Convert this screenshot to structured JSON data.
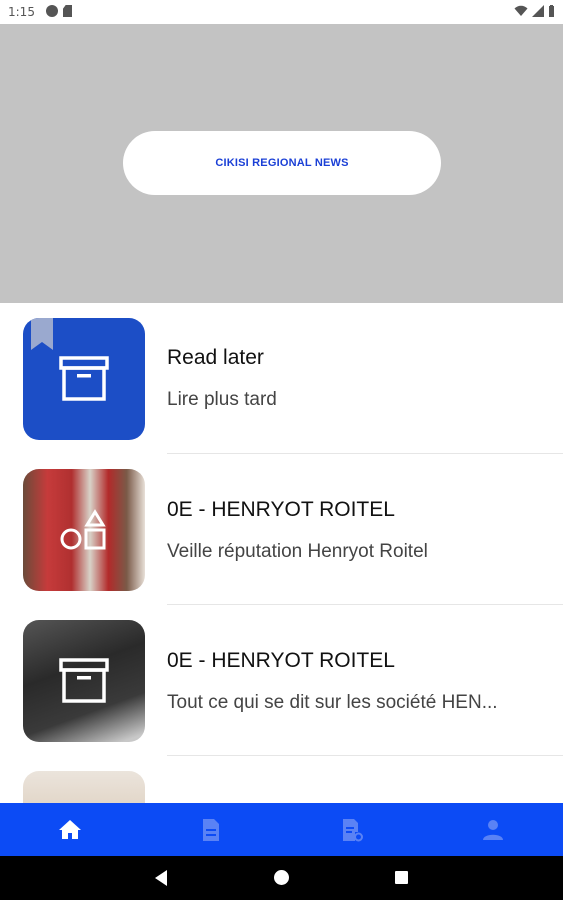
{
  "status_bar": {
    "time": "1:15"
  },
  "header": {
    "brand": "CIKISI REGIONAL NEWS"
  },
  "list": {
    "items": [
      {
        "title": "Read later",
        "subtitle": "Lire plus tard",
        "icon": "archive-box-icon"
      },
      {
        "title": "0E - HENRYOT ROITEL",
        "subtitle": "Veille réputation Henryot Roitel",
        "icon": "shapes-icon"
      },
      {
        "title": "0E - HENRYOT ROITEL",
        "subtitle": "Tout ce qui se dit sur les société HEN...",
        "icon": "archive-box-icon"
      },
      {
        "title": "",
        "subtitle": ""
      }
    ]
  },
  "bottom_nav": {
    "items": [
      {
        "name": "home",
        "icon": "home-icon",
        "active": true
      },
      {
        "name": "document",
        "icon": "document-icon",
        "active": false
      },
      {
        "name": "document-settings",
        "icon": "document-settings-icon",
        "active": false
      },
      {
        "name": "profile",
        "icon": "person-icon",
        "active": false
      }
    ]
  },
  "colors": {
    "header_bg": "#c3c3c3",
    "brand_text": "#1a3fd6",
    "nav_bg": "#0c4bf5",
    "tile_blue": "#1c4ec6"
  }
}
